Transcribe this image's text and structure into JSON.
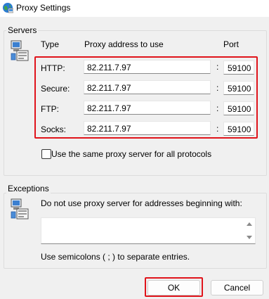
{
  "window": {
    "title": "Proxy Settings",
    "icon": "globe-icon"
  },
  "servers": {
    "group_label": "Servers",
    "icon": "network-computer-icon",
    "headers": {
      "type": "Type",
      "address": "Proxy address to use",
      "port": "Port"
    },
    "rows": [
      {
        "label": "HTTP:",
        "address": "82.211.7.97",
        "port": "59100"
      },
      {
        "label": "Secure:",
        "address": "82.211.7.97",
        "port": "59100"
      },
      {
        "label": "FTP:",
        "address": "82.211.7.97",
        "port": "59100"
      },
      {
        "label": "Socks:",
        "address": "82.211.7.97",
        "port": "59100"
      }
    ],
    "separator": ":",
    "same_proxy_checkbox": {
      "label": "Use the same proxy server for all protocols",
      "checked": false
    }
  },
  "exceptions": {
    "group_label": "Exceptions",
    "icon": "network-computer-icon",
    "description": "Do not use proxy server for addresses beginning with:",
    "value": "",
    "hint": "Use semicolons ( ; ) to separate entries."
  },
  "buttons": {
    "ok": "OK",
    "cancel": "Cancel"
  },
  "colors": {
    "highlight": "#e0141b",
    "background": "#f0f0f0"
  }
}
